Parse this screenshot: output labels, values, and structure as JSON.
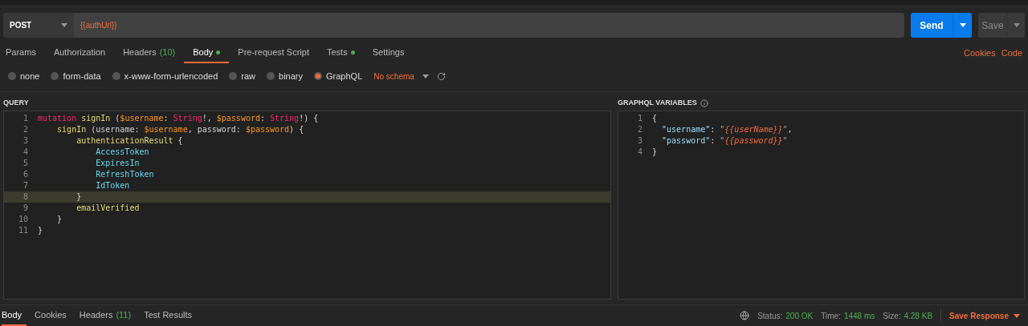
{
  "request": {
    "method": "POST",
    "url": "{{authUrl}}",
    "send_label": "Send",
    "save_label": "Save"
  },
  "tabs": [
    {
      "label": "Params",
      "selected": false
    },
    {
      "label": "Authorization",
      "selected": false
    },
    {
      "label": "Headers",
      "count": "(10)",
      "selected": false
    },
    {
      "label": "Body",
      "dot": true,
      "selected": true
    },
    {
      "label": "Pre-request Script",
      "selected": false
    },
    {
      "label": "Tests",
      "dot": true,
      "selected": false
    },
    {
      "label": "Settings",
      "selected": false
    }
  ],
  "links": [
    "Cookies",
    "Code"
  ],
  "body_types": [
    {
      "label": "none",
      "selected": false
    },
    {
      "label": "form-data",
      "selected": false
    },
    {
      "label": "x-www-form-urlencoded",
      "selected": false
    },
    {
      "label": "raw",
      "selected": false
    },
    {
      "label": "binary",
      "selected": false
    },
    {
      "label": "GraphQL",
      "selected": true
    }
  ],
  "schema": "No schema",
  "query": {
    "title": "QUERY",
    "lines": [
      {
        "number": "1",
        "active": false,
        "tokens": [
          {
            "text": "mutation ",
            "kind": "keyword"
          },
          {
            "text": "signIn",
            "kind": "name"
          },
          {
            "text": " (",
            "kind": "plain"
          },
          {
            "text": "$username",
            "kind": "variable"
          },
          {
            "text": ": ",
            "kind": "plain"
          },
          {
            "text": "String",
            "kind": "keyword"
          },
          {
            "text": "!, ",
            "kind": "plain"
          },
          {
            "text": "$password",
            "kind": "variable"
          },
          {
            "text": ": ",
            "kind": "plain"
          },
          {
            "text": "String",
            "kind": "keyword"
          },
          {
            "text": "!) {",
            "kind": "plain"
          }
        ]
      },
      {
        "number": "2",
        "active": false,
        "tokens": [
          {
            "text": "    signIn",
            "kind": "name"
          },
          {
            "text": " (username: ",
            "kind": "plain"
          },
          {
            "text": "$username",
            "kind": "variable"
          },
          {
            "text": ", password: ",
            "kind": "plain"
          },
          {
            "text": "$password",
            "kind": "variable"
          },
          {
            "text": ") {",
            "kind": "plain"
          }
        ]
      },
      {
        "number": "3",
        "active": false,
        "tokens": [
          {
            "text": "        authenticationResult",
            "kind": "name"
          },
          {
            "text": " {",
            "kind": "plain"
          }
        ]
      },
      {
        "number": "4",
        "active": false,
        "tokens": [
          {
            "text": "            AccessToken",
            "kind": "field"
          }
        ]
      },
      {
        "number": "5",
        "active": false,
        "tokens": [
          {
            "text": "            ExpiresIn",
            "kind": "field"
          }
        ]
      },
      {
        "number": "6",
        "active": false,
        "tokens": [
          {
            "text": "            RefreshToken",
            "kind": "field"
          }
        ]
      },
      {
        "number": "7",
        "active": false,
        "tokens": [
          {
            "text": "            IdToken",
            "kind": "field"
          }
        ]
      },
      {
        "number": "8",
        "active": true,
        "tokens": [
          {
            "text": "        }",
            "kind": "plain"
          }
        ]
      },
      {
        "number": "9",
        "active": false,
        "tokens": [
          {
            "text": "        emailVerified",
            "kind": "name"
          }
        ]
      },
      {
        "number": "10",
        "active": false,
        "tokens": [
          {
            "text": "    }",
            "kind": "plain"
          }
        ]
      },
      {
        "number": "11",
        "active": false,
        "tokens": [
          {
            "text": "}",
            "kind": "plain"
          }
        ]
      }
    ]
  },
  "variables": {
    "title": "GRAPHQL VARIABLES",
    "lines": [
      {
        "number": "1",
        "tokens": [
          {
            "text": "{",
            "kind": "plain"
          }
        ]
      },
      {
        "number": "2",
        "tokens": [
          {
            "text": "  \"username\"",
            "kind": "key"
          },
          {
            "text": ": ",
            "kind": "plain"
          },
          {
            "text": "\"",
            "kind": "quote"
          },
          {
            "text": "{{userName}}",
            "kind": "template"
          },
          {
            "text": "\"",
            "kind": "quote"
          },
          {
            "text": ",",
            "kind": "plain"
          }
        ]
      },
      {
        "number": "3",
        "tokens": [
          {
            "text": "  \"password\"",
            "kind": "key"
          },
          {
            "text": ": ",
            "kind": "plain"
          },
          {
            "text": "\"",
            "kind": "quote"
          },
          {
            "text": "{{password}}",
            "kind": "template"
          },
          {
            "text": "\"",
            "kind": "quote"
          }
        ]
      },
      {
        "number": "4",
        "tokens": [
          {
            "text": "}",
            "kind": "plain"
          }
        ]
      }
    ]
  },
  "response_tabs": [
    {
      "label": "Body",
      "selected": true
    },
    {
      "label": "Cookies",
      "selected": false
    },
    {
      "label": "Headers",
      "count": "(11)",
      "selected": false
    },
    {
      "label": "Test Results",
      "selected": false
    }
  ],
  "status": {
    "status_label": "Status:",
    "status_value": "200 OK",
    "time_label": "Time:",
    "time_value": "1448 ms",
    "size_label": "Size:",
    "size_value": "4.28 KB",
    "save_response": "Save Response"
  }
}
